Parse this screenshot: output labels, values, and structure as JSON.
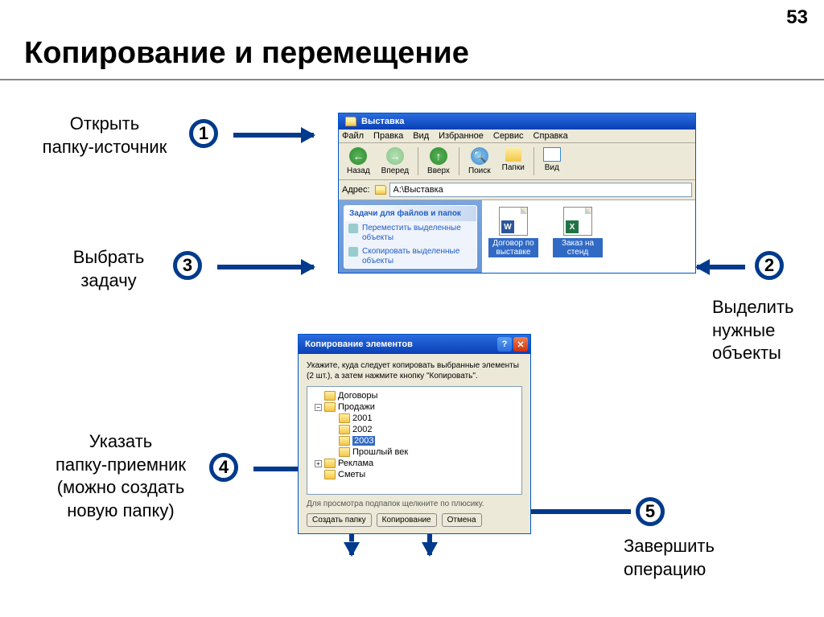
{
  "page_number": "53",
  "title": "Копирование и перемещение",
  "steps": {
    "s1": {
      "num": "1",
      "label": "Открыть\nпапку-источник"
    },
    "s2": {
      "num": "2",
      "label": "Выделить\nнужные\nобъекты"
    },
    "s3": {
      "num": "3",
      "label": "Выбрать\nзадачу"
    },
    "s4": {
      "num": "4",
      "label": "Указать\nпапку-приемник\n(можно создать\nновую папку)"
    },
    "s5": {
      "num": "5",
      "label": "Завершить\nоперацию"
    }
  },
  "explorer": {
    "title": "Выставка",
    "menus": [
      "Файл",
      "Правка",
      "Вид",
      "Избранное",
      "Сервис",
      "Справка"
    ],
    "toolbar": {
      "back": "Назад",
      "forward": "Вперед",
      "up": "Вверх",
      "search": "Поиск",
      "folders": "Папки",
      "view": "Вид"
    },
    "address_label": "Адрес:",
    "address_value": "A:\\Выставка",
    "task_panel_title": "Задачи для файлов и папок",
    "task_move": "Переместить выделенные объекты",
    "task_copy": "Скопировать выделенные объекты",
    "file1": "Договор по выставке",
    "file2": "Заказ на стенд"
  },
  "dialog": {
    "title": "Копирование элементов",
    "instructions": "Укажите, куда следует копировать выбранные элементы (2 шт.), а затем нажмите кнопку \"Копировать\".",
    "tree": {
      "n1": "Договоры",
      "n2": "Продажи",
      "n3": "2001",
      "n4": "2002",
      "n5": "2003",
      "n6": "Прошлый век",
      "n7": "Реклама",
      "n8": "Сметы"
    },
    "hint": "Для просмотра подпапок щелкните по плюсику.",
    "btn_new": "Создать папку",
    "btn_copy": "Копирование",
    "btn_cancel": "Отмена"
  }
}
